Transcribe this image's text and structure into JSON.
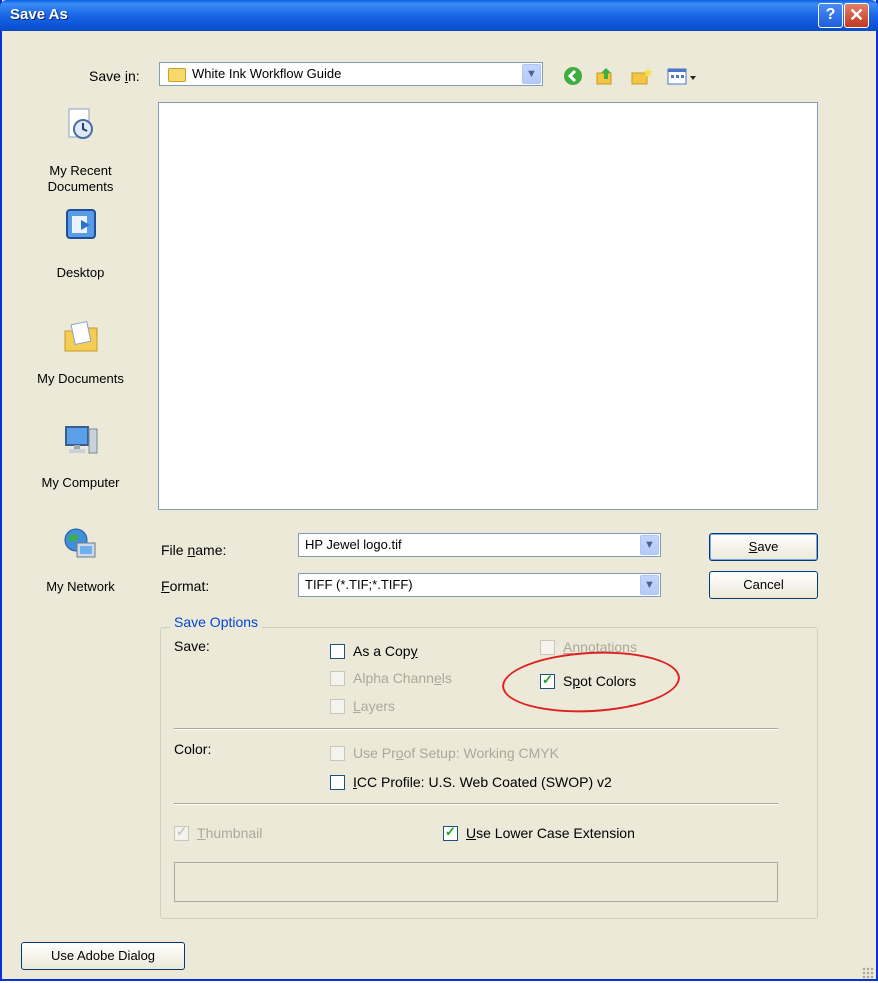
{
  "window": {
    "title": "Save As",
    "help_glyph": "?",
    "close_glyph": "✕"
  },
  "save_in": {
    "label_pre": "Save ",
    "label_u": "i",
    "label_post": "n:",
    "value": "White Ink Workflow Guide"
  },
  "toolbar_icons": [
    "back-icon",
    "up-folder-icon",
    "new-folder-icon",
    "views-menu-icon"
  ],
  "places": [
    {
      "id": "recent",
      "label": "My Recent Documents",
      "icon": "recent-documents-icon"
    },
    {
      "id": "desktop",
      "label": "Desktop",
      "icon": "desktop-icon"
    },
    {
      "id": "documents",
      "label": "My Documents",
      "icon": "my-documents-icon"
    },
    {
      "id": "computer",
      "label": "My Computer",
      "icon": "my-computer-icon"
    },
    {
      "id": "network",
      "label": "My Network",
      "icon": "my-network-icon"
    }
  ],
  "file_name": {
    "label_pre": "File ",
    "label_u": "n",
    "label_post": "ame:",
    "value": "HP Jewel logo.tif"
  },
  "format": {
    "label_u": "F",
    "label_post": "ormat:",
    "value": "TIFF (*.TIF;*.TIFF)"
  },
  "buttons": {
    "save": {
      "u": "S",
      "rest": "ave"
    },
    "cancel": "Cancel",
    "adobe": "Use Adobe Dialog"
  },
  "save_options": {
    "legend": "Save Options",
    "save_label": "Save:",
    "as_copy": {
      "pre": "As a Cop",
      "u": "y",
      "post": "",
      "checked": false,
      "enabled": true
    },
    "alpha_channels": {
      "pre": "Alpha Chann",
      "u": "e",
      "post": "ls",
      "checked": false,
      "enabled": false
    },
    "layers": {
      "pre": "",
      "u": "L",
      "post": "ayers",
      "checked": false,
      "enabled": false
    },
    "annotations": {
      "pre": "",
      "u": "A",
      "post": "nnotations",
      "checked": false,
      "enabled": false
    },
    "spot_colors": {
      "pre": "S",
      "u": "p",
      "post": "ot Colors",
      "checked": true,
      "enabled": true
    },
    "color_label": "Color:",
    "use_proof": {
      "pre": "Use Pr",
      "u": "o",
      "post": "of Setup:  Working CMYK",
      "checked": false,
      "enabled": false
    },
    "icc_profile": {
      "pre": "",
      "u": "I",
      "post": "CC Profile:  U.S. Web Coated (SWOP) v2",
      "checked": false,
      "enabled": true
    },
    "thumbnail": {
      "pre": "",
      "u": "T",
      "post": "humbnail",
      "checked": true,
      "enabled": false
    },
    "lower_case": {
      "pre": "",
      "u": "U",
      "post": "se Lower Case Extension",
      "checked": true,
      "enabled": true
    }
  },
  "colors": {
    "title_bar": "#0a5fe6",
    "dialog_bg": "#ece9d8",
    "highlight_ellipse": "#e02020",
    "group_legend": "#0046d5"
  }
}
